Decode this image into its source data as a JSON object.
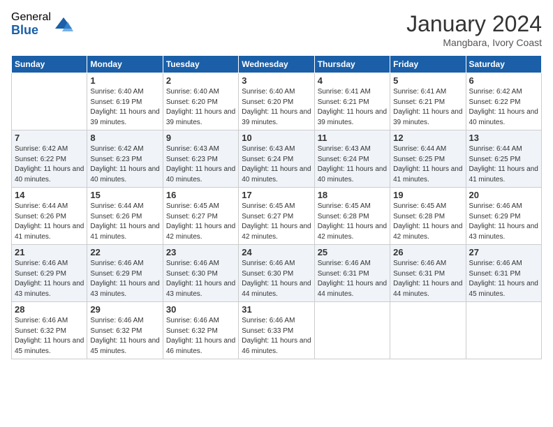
{
  "logo": {
    "general": "General",
    "blue": "Blue"
  },
  "header": {
    "month": "January 2024",
    "location": "Mangbara, Ivory Coast"
  },
  "weekdays": [
    "Sunday",
    "Monday",
    "Tuesday",
    "Wednesday",
    "Thursday",
    "Friday",
    "Saturday"
  ],
  "weeks": [
    [
      {
        "day": "",
        "sunrise": "",
        "sunset": "",
        "daylight": ""
      },
      {
        "day": "1",
        "sunrise": "Sunrise: 6:40 AM",
        "sunset": "Sunset: 6:19 PM",
        "daylight": "Daylight: 11 hours and 39 minutes."
      },
      {
        "day": "2",
        "sunrise": "Sunrise: 6:40 AM",
        "sunset": "Sunset: 6:20 PM",
        "daylight": "Daylight: 11 hours and 39 minutes."
      },
      {
        "day": "3",
        "sunrise": "Sunrise: 6:40 AM",
        "sunset": "Sunset: 6:20 PM",
        "daylight": "Daylight: 11 hours and 39 minutes."
      },
      {
        "day": "4",
        "sunrise": "Sunrise: 6:41 AM",
        "sunset": "Sunset: 6:21 PM",
        "daylight": "Daylight: 11 hours and 39 minutes."
      },
      {
        "day": "5",
        "sunrise": "Sunrise: 6:41 AM",
        "sunset": "Sunset: 6:21 PM",
        "daylight": "Daylight: 11 hours and 39 minutes."
      },
      {
        "day": "6",
        "sunrise": "Sunrise: 6:42 AM",
        "sunset": "Sunset: 6:22 PM",
        "daylight": "Daylight: 11 hours and 40 minutes."
      }
    ],
    [
      {
        "day": "7",
        "sunrise": "Sunrise: 6:42 AM",
        "sunset": "Sunset: 6:22 PM",
        "daylight": "Daylight: 11 hours and 40 minutes."
      },
      {
        "day": "8",
        "sunrise": "Sunrise: 6:42 AM",
        "sunset": "Sunset: 6:23 PM",
        "daylight": "Daylight: 11 hours and 40 minutes."
      },
      {
        "day": "9",
        "sunrise": "Sunrise: 6:43 AM",
        "sunset": "Sunset: 6:23 PM",
        "daylight": "Daylight: 11 hours and 40 minutes."
      },
      {
        "day": "10",
        "sunrise": "Sunrise: 6:43 AM",
        "sunset": "Sunset: 6:24 PM",
        "daylight": "Daylight: 11 hours and 40 minutes."
      },
      {
        "day": "11",
        "sunrise": "Sunrise: 6:43 AM",
        "sunset": "Sunset: 6:24 PM",
        "daylight": "Daylight: 11 hours and 40 minutes."
      },
      {
        "day": "12",
        "sunrise": "Sunrise: 6:44 AM",
        "sunset": "Sunset: 6:25 PM",
        "daylight": "Daylight: 11 hours and 41 minutes."
      },
      {
        "day": "13",
        "sunrise": "Sunrise: 6:44 AM",
        "sunset": "Sunset: 6:25 PM",
        "daylight": "Daylight: 11 hours and 41 minutes."
      }
    ],
    [
      {
        "day": "14",
        "sunrise": "Sunrise: 6:44 AM",
        "sunset": "Sunset: 6:26 PM",
        "daylight": "Daylight: 11 hours and 41 minutes."
      },
      {
        "day": "15",
        "sunrise": "Sunrise: 6:44 AM",
        "sunset": "Sunset: 6:26 PM",
        "daylight": "Daylight: 11 hours and 41 minutes."
      },
      {
        "day": "16",
        "sunrise": "Sunrise: 6:45 AM",
        "sunset": "Sunset: 6:27 PM",
        "daylight": "Daylight: 11 hours and 42 minutes."
      },
      {
        "day": "17",
        "sunrise": "Sunrise: 6:45 AM",
        "sunset": "Sunset: 6:27 PM",
        "daylight": "Daylight: 11 hours and 42 minutes."
      },
      {
        "day": "18",
        "sunrise": "Sunrise: 6:45 AM",
        "sunset": "Sunset: 6:28 PM",
        "daylight": "Daylight: 11 hours and 42 minutes."
      },
      {
        "day": "19",
        "sunrise": "Sunrise: 6:45 AM",
        "sunset": "Sunset: 6:28 PM",
        "daylight": "Daylight: 11 hours and 42 minutes."
      },
      {
        "day": "20",
        "sunrise": "Sunrise: 6:46 AM",
        "sunset": "Sunset: 6:29 PM",
        "daylight": "Daylight: 11 hours and 43 minutes."
      }
    ],
    [
      {
        "day": "21",
        "sunrise": "Sunrise: 6:46 AM",
        "sunset": "Sunset: 6:29 PM",
        "daylight": "Daylight: 11 hours and 43 minutes."
      },
      {
        "day": "22",
        "sunrise": "Sunrise: 6:46 AM",
        "sunset": "Sunset: 6:29 PM",
        "daylight": "Daylight: 11 hours and 43 minutes."
      },
      {
        "day": "23",
        "sunrise": "Sunrise: 6:46 AM",
        "sunset": "Sunset: 6:30 PM",
        "daylight": "Daylight: 11 hours and 43 minutes."
      },
      {
        "day": "24",
        "sunrise": "Sunrise: 6:46 AM",
        "sunset": "Sunset: 6:30 PM",
        "daylight": "Daylight: 11 hours and 44 minutes."
      },
      {
        "day": "25",
        "sunrise": "Sunrise: 6:46 AM",
        "sunset": "Sunset: 6:31 PM",
        "daylight": "Daylight: 11 hours and 44 minutes."
      },
      {
        "day": "26",
        "sunrise": "Sunrise: 6:46 AM",
        "sunset": "Sunset: 6:31 PM",
        "daylight": "Daylight: 11 hours and 44 minutes."
      },
      {
        "day": "27",
        "sunrise": "Sunrise: 6:46 AM",
        "sunset": "Sunset: 6:31 PM",
        "daylight": "Daylight: 11 hours and 45 minutes."
      }
    ],
    [
      {
        "day": "28",
        "sunrise": "Sunrise: 6:46 AM",
        "sunset": "Sunset: 6:32 PM",
        "daylight": "Daylight: 11 hours and 45 minutes."
      },
      {
        "day": "29",
        "sunrise": "Sunrise: 6:46 AM",
        "sunset": "Sunset: 6:32 PM",
        "daylight": "Daylight: 11 hours and 45 minutes."
      },
      {
        "day": "30",
        "sunrise": "Sunrise: 6:46 AM",
        "sunset": "Sunset: 6:32 PM",
        "daylight": "Daylight: 11 hours and 46 minutes."
      },
      {
        "day": "31",
        "sunrise": "Sunrise: 6:46 AM",
        "sunset": "Sunset: 6:33 PM",
        "daylight": "Daylight: 11 hours and 46 minutes."
      },
      {
        "day": "",
        "sunrise": "",
        "sunset": "",
        "daylight": ""
      },
      {
        "day": "",
        "sunrise": "",
        "sunset": "",
        "daylight": ""
      },
      {
        "day": "",
        "sunrise": "",
        "sunset": "",
        "daylight": ""
      }
    ]
  ]
}
